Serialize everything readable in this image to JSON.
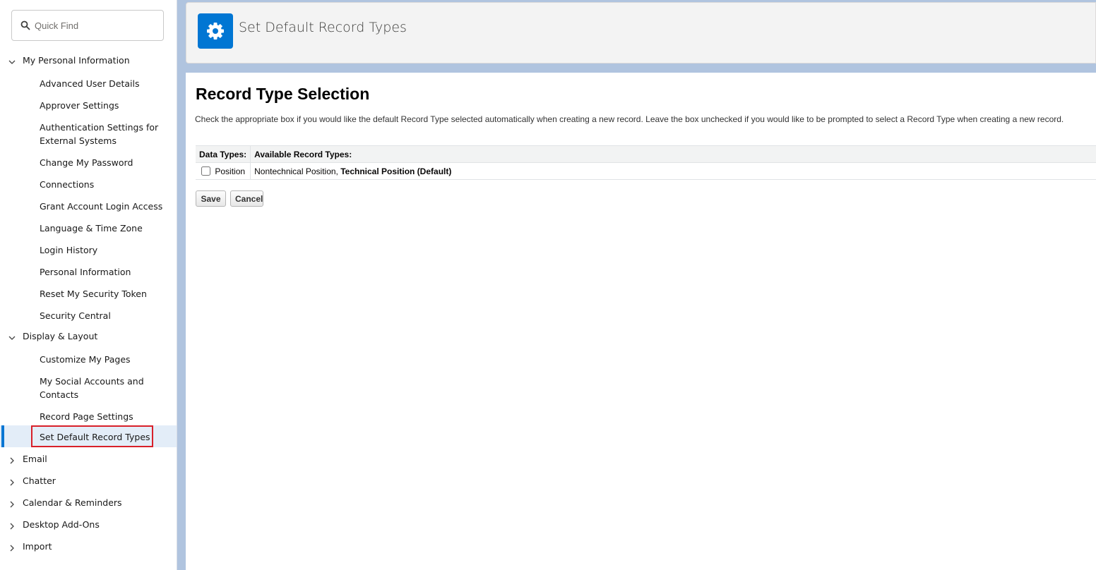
{
  "search": {
    "placeholder": "Quick Find",
    "icon": "search-icon"
  },
  "sidebar": {
    "sections": [
      {
        "label": "My Personal Information",
        "expanded": true,
        "items": [
          "Advanced User Details",
          "Approver Settings",
          "Authentication Settings for External Systems",
          "Change My Password",
          "Connections",
          "Grant Account Login Access",
          "Language & Time Zone",
          "Login History",
          "Personal Information",
          "Reset My Security Token",
          "Security Central"
        ]
      },
      {
        "label": "Display & Layout",
        "expanded": true,
        "items": [
          "Customize My Pages",
          "My Social Accounts and Contacts",
          "Record Page Settings",
          "Set Default Record Types"
        ]
      },
      {
        "label": "Email",
        "expanded": false
      },
      {
        "label": "Chatter",
        "expanded": false
      },
      {
        "label": "Calendar & Reminders",
        "expanded": false
      },
      {
        "label": "Desktop Add-Ons",
        "expanded": false
      },
      {
        "label": "Import",
        "expanded": false
      }
    ],
    "active_item": "Set Default Record Types"
  },
  "header": {
    "title": "Set Default Record Types",
    "icon": "gear-icon"
  },
  "main": {
    "heading": "Record Type Selection",
    "instructions": "Check the appropriate box if you would like the default Record Type selected automatically when creating a new record. Leave the box unchecked if you would like to be prompted to select a Record Type when creating a new record.",
    "table": {
      "headers": [
        "Data Types:",
        "Available Record Types:"
      ],
      "rows": [
        {
          "data_type": "Position",
          "checked": false,
          "available_plain": "Nontechnical Position, ",
          "available_bold": "Technical Position (Default)"
        }
      ]
    },
    "buttons": {
      "save": "Save",
      "cancel": "Cancel"
    }
  },
  "colors": {
    "accent": "#0176d3",
    "highlight": "#d8202a",
    "active_bg": "#e3edf8"
  }
}
